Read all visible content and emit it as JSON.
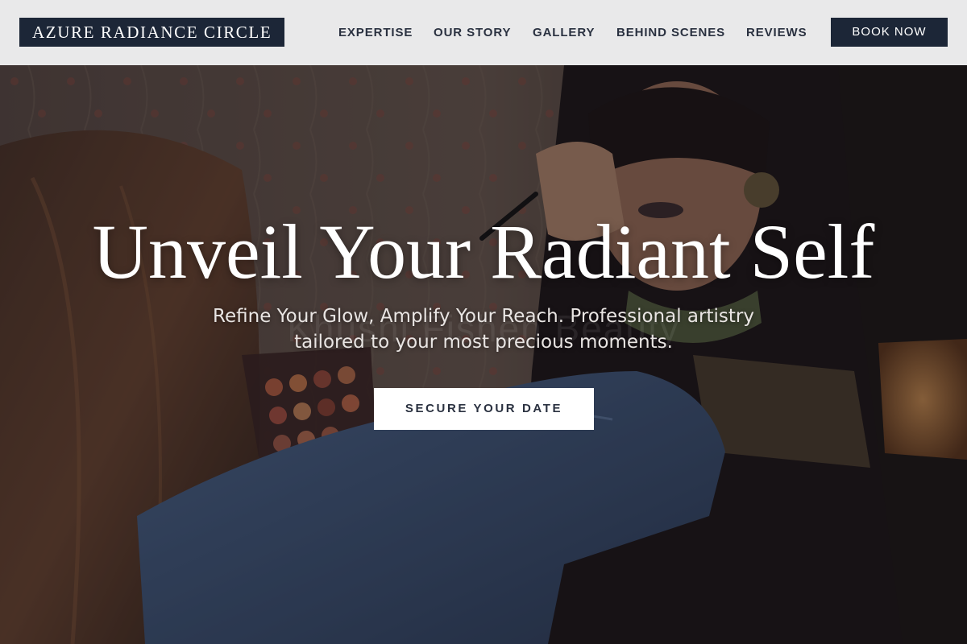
{
  "brand": {
    "name": "AZURE RADIANCE CIRCLE"
  },
  "nav": {
    "items": [
      {
        "label": "EXPERTISE"
      },
      {
        "label": "OUR STORY"
      },
      {
        "label": "GALLERY"
      },
      {
        "label": "BEHIND SCENES"
      },
      {
        "label": "REVIEWS"
      }
    ],
    "cta_label": "BOOK NOW"
  },
  "hero": {
    "title": "Unveil Your Radiant Self",
    "subtitle": "Refine Your Glow, Amplify Your Reach. Professional artistry tailored to your most precious moments.",
    "cta_label": "SECURE YOUR DATE",
    "watermark": "Khushi Fishen Beauty",
    "background_image": "makeup-artist-applying-bridal-makeup-photo"
  },
  "colors": {
    "header_bg": "#e9e9ea",
    "brand_navy": "#1c2637",
    "nav_text": "#2a3140",
    "hero_text": "#ffffff",
    "cta_bg": "#ffffff"
  }
}
